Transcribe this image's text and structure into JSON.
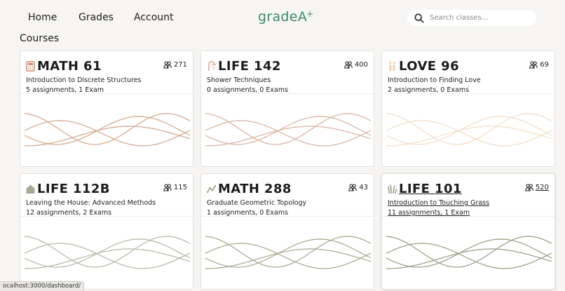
{
  "nav": {
    "home": "Home",
    "grades": "Grades",
    "account": "Account",
    "logo_main": "gradeA",
    "logo_sup": "+",
    "search_placeholder": "Search classes..."
  },
  "section_title": "Courses",
  "courses": [
    {
      "icon": "calculator-icon",
      "code": "MATH 61",
      "name": "Introduction to Discrete Structures",
      "meta": "5 assignments, 1 Exam",
      "enrolled": "271",
      "wave_color": "#d4a48a"
    },
    {
      "icon": "shower-icon",
      "code": "LIFE 142",
      "name": "Shower Techniques",
      "meta": "0 assignments, 0 Exams",
      "enrolled": "400",
      "wave_color": "#d9b09c"
    },
    {
      "icon": "couple-icon",
      "code": "LOVE 96",
      "name": "Introduction to Finding Love",
      "meta": "2 assignments, 0 Exams",
      "enrolled": "69",
      "wave_color": "#f3dcc6"
    },
    {
      "icon": "house-icon",
      "code": "LIFE 112B",
      "name": "Leaving the House: Advanced Methods",
      "meta": "12 assignments, 2 Exams",
      "enrolled": "115",
      "wave_color": "#b8b4a4"
    },
    {
      "icon": "trend-icon",
      "code": "MATH 288",
      "name": "Graduate Geometric Topology",
      "meta": "1 assignments, 0 Exams",
      "enrolled": "43",
      "wave_color": "#a9a58e"
    },
    {
      "icon": "grass-icon",
      "code": "LIFE 101",
      "name": "Introduction to Touching Grass",
      "meta": "11 assignments, 1 Exam",
      "enrolled": "520",
      "wave_color": "#9c9982"
    }
  ],
  "status_bar": "ocalhost:3000/dashboard/"
}
